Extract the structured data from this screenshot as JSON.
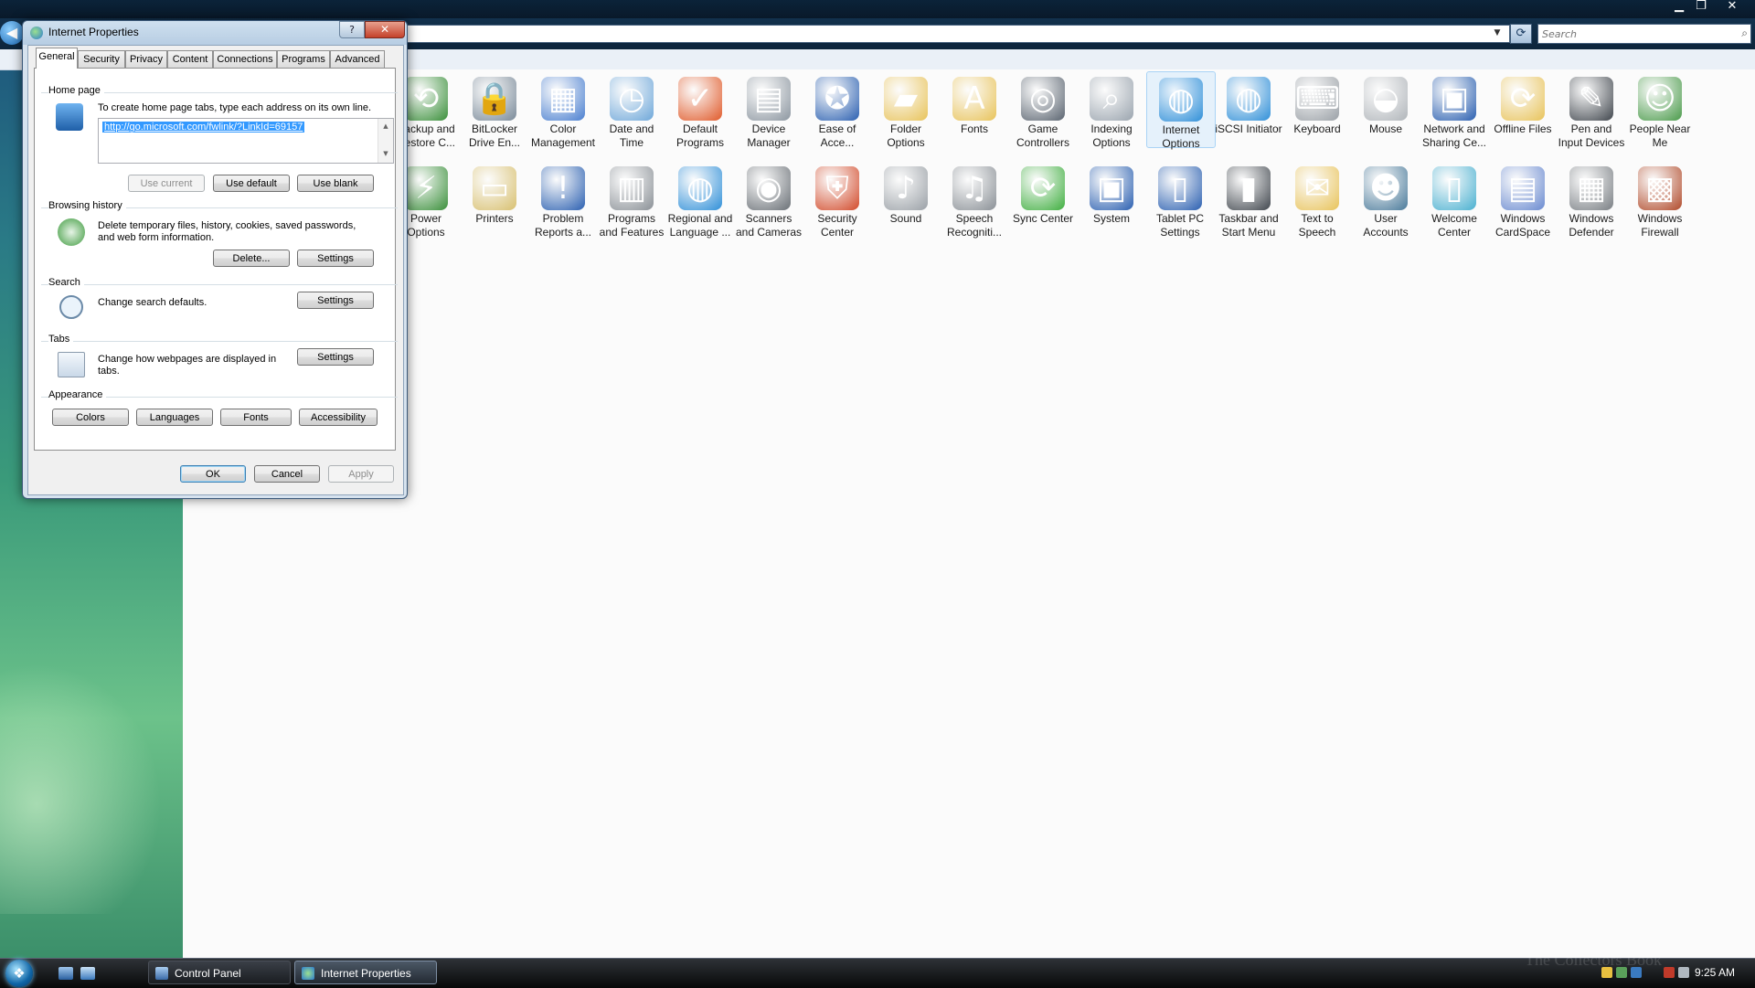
{
  "explorer": {
    "search_placeholder": "Search",
    "items": [
      {
        "label": "Backup and Restore C...",
        "icon": "backup-icon",
        "color": "#3a8f3a"
      },
      {
        "label": "BitLocker Drive En...",
        "icon": "bitlocker-icon",
        "color": "#7a8a99"
      },
      {
        "label": "Color Management",
        "icon": "color-management-icon",
        "color": "#4a7fd0"
      },
      {
        "label": "Date and Time",
        "icon": "date-time-icon",
        "color": "#6ea7d9"
      },
      {
        "label": "Default Programs",
        "icon": "default-programs-icon",
        "color": "#e05a2a"
      },
      {
        "label": "Device Manager",
        "icon": "device-manager-icon",
        "color": "#8c96a0"
      },
      {
        "label": "Ease of Acce...",
        "icon": "ease-of-access-icon",
        "color": "#2a5fb0"
      },
      {
        "label": "Folder Options",
        "icon": "folder-options-icon",
        "color": "#e8c35a"
      },
      {
        "label": "Fonts",
        "icon": "fonts-icon",
        "color": "#e8c35a"
      },
      {
        "label": "Game Controllers",
        "icon": "game-controllers-icon",
        "color": "#5a6470"
      },
      {
        "label": "Indexing Options",
        "icon": "indexing-options-icon",
        "color": "#9aa4ae"
      },
      {
        "label": "Internet Options",
        "icon": "internet-options-icon",
        "color": "#2f8fd8"
      },
      {
        "label": "iSCSI Initiator",
        "icon": "iscsi-initiator-icon",
        "color": "#2f8fd8"
      },
      {
        "label": "Keyboard",
        "icon": "keyboard-icon",
        "color": "#9aa0a6"
      },
      {
        "label": "Mouse",
        "icon": "mouse-icon",
        "color": "#b0b5ba"
      },
      {
        "label": "Network and Sharing Ce...",
        "icon": "network-sharing-icon",
        "color": "#2a5fb0"
      },
      {
        "label": "Offline Files",
        "icon": "offline-files-icon",
        "color": "#e8c35a"
      },
      {
        "label": "Pen and Input Devices",
        "icon": "pen-input-icon",
        "color": "#40464d"
      },
      {
        "label": "People Near Me",
        "icon": "people-near-me-icon",
        "color": "#4a9a4a"
      },
      {
        "label": "Power Options",
        "icon": "power-options-icon",
        "color": "#3a8f3a"
      },
      {
        "label": "Printers",
        "icon": "printers-icon",
        "color": "#d8c070"
      },
      {
        "label": "Problem Reports a...",
        "icon": "problem-reports-icon",
        "color": "#2a5fb0"
      },
      {
        "label": "Programs and Features",
        "icon": "programs-features-icon",
        "color": "#8a9096"
      },
      {
        "label": "Regional and Language ...",
        "icon": "regional-language-icon",
        "color": "#2f8fd8"
      },
      {
        "label": "Scanners and Cameras",
        "icon": "scanners-cameras-icon",
        "color": "#6a7076"
      },
      {
        "label": "Security Center",
        "icon": "security-center-icon",
        "color": "#d24a2a"
      },
      {
        "label": "Sound",
        "icon": "sound-icon",
        "color": "#9aa0a6"
      },
      {
        "label": "Speech Recogniti...",
        "icon": "speech-recognition-icon",
        "color": "#8a9096"
      },
      {
        "label": "Sync Center",
        "icon": "sync-center-icon",
        "color": "#3fae3f"
      },
      {
        "label": "System",
        "icon": "system-icon",
        "color": "#2a5fb0"
      },
      {
        "label": "Tablet PC Settings",
        "icon": "tablet-pc-icon",
        "color": "#2a5fb0"
      },
      {
        "label": "Taskbar and Start Menu",
        "icon": "taskbar-start-icon",
        "color": "#40464d"
      },
      {
        "label": "Text to Speech",
        "icon": "text-to-speech-icon",
        "color": "#e8c35a"
      },
      {
        "label": "User Accounts",
        "icon": "user-accounts-icon",
        "color": "#4a7a9a"
      },
      {
        "label": "Welcome Center",
        "icon": "welcome-center-icon",
        "color": "#4ab0d0"
      },
      {
        "label": "Windows CardSpace",
        "icon": "cardspace-icon",
        "color": "#6a8ad0"
      },
      {
        "label": "Windows Defender",
        "icon": "defender-icon",
        "color": "#7a7f84"
      },
      {
        "label": "Windows Firewall",
        "icon": "firewall-icon",
        "color": "#b04a2a"
      }
    ],
    "selected_item": "Internet Options"
  },
  "dialog": {
    "title": "Internet Properties",
    "help_label": "?",
    "close_label": "✕",
    "tabs": [
      "General",
      "Security",
      "Privacy",
      "Content",
      "Connections",
      "Programs",
      "Advanced"
    ],
    "active_tab": "General",
    "home_page": {
      "group_title": "Home page",
      "instruction": "To create home page tabs, type each address on its own line.",
      "url": "http://go.microsoft.com/fwlink/?LinkId=69157",
      "use_current": "Use current",
      "use_default": "Use default",
      "use_blank": "Use blank"
    },
    "browsing_history": {
      "group_title": "Browsing history",
      "description": "Delete temporary files, history, cookies, saved passwords, and web form information.",
      "delete_label": "Delete...",
      "settings_label": "Settings"
    },
    "search": {
      "group_title": "Search",
      "description": "Change search defaults.",
      "settings_label": "Settings"
    },
    "tabs_group": {
      "group_title": "Tabs",
      "description": "Change how webpages are displayed in tabs.",
      "settings_label": "Settings"
    },
    "appearance": {
      "group_title": "Appearance",
      "colors": "Colors",
      "languages": "Languages",
      "fonts": "Fonts",
      "accessibility": "Accessibility"
    },
    "ok": "OK",
    "cancel": "Cancel",
    "apply": "Apply"
  },
  "taskbar": {
    "buttons": [
      {
        "label": "Control Panel",
        "icon": "control-panel-icon"
      },
      {
        "label": "Internet Properties",
        "icon": "internet-properties-icon"
      }
    ],
    "clock": "9:25 AM",
    "watermark": "The Collectors Book"
  },
  "colors": {
    "accent": "#3399ff",
    "titlebar": "#0b2339",
    "taskbar": "#070808"
  }
}
